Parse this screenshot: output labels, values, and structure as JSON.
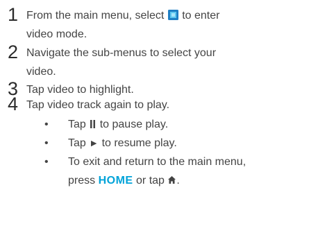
{
  "steps": [
    {
      "number": "1",
      "line1_before_icon": "From the main menu, select",
      "icon": "video-mode-icon",
      "line1_after_icon": "to enter",
      "line2": "video mode."
    },
    {
      "number": "2",
      "line1": "Navigate the sub-menus to select your",
      "line2": "video."
    },
    {
      "number": "3",
      "line1": "Tap video to highlight."
    },
    {
      "number": "4",
      "line1": "Tap video track again to play."
    }
  ],
  "bullets": [
    {
      "marker": "•",
      "before_icon": "Tap",
      "icon": "pause-icon",
      "after_icon": "to pause play."
    },
    {
      "marker": "•",
      "before_icon": "Tap",
      "icon": "play-icon",
      "icon_glyph": "►",
      "after_icon": "to resume play."
    },
    {
      "marker": "•",
      "line1": "To exit and return to the main menu,",
      "line2_before": "press",
      "home_word": "HOME",
      "line2_middle": "or tap",
      "icon": "home-icon",
      "line2_after": "."
    }
  ],
  "colors": {
    "text": "#444444",
    "number": "#2b2b2b",
    "accent": "#00a3d9",
    "video_icon_outer": "#1f7fc4",
    "video_icon_inner": "#5ec7ef"
  }
}
